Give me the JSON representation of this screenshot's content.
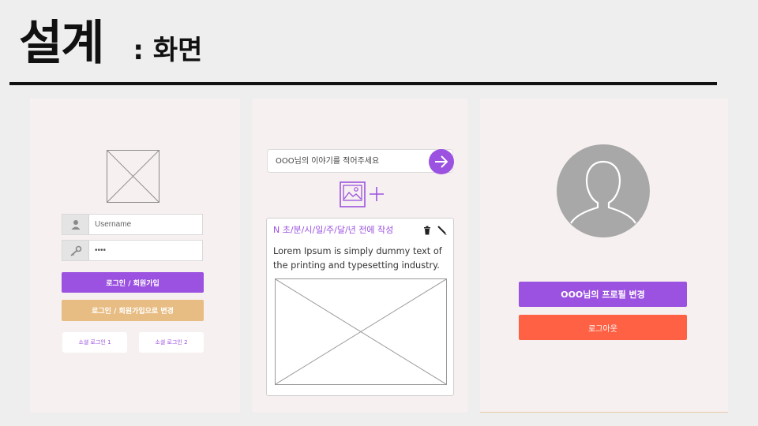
{
  "slide": {
    "title": "설계",
    "subtitle": ": 화면"
  },
  "login_screen": {
    "username_placeholder": "Username",
    "password_value": "••••",
    "login_button": "로그인 / 회원가입",
    "switch_button": "로그인 / 회원가입으로 변경",
    "social_login_1": "소셜 로그인 1",
    "social_login_2": "소셜 로그인 2",
    "icons": [
      "user-icon",
      "key-icon",
      "image-placeholder-icon"
    ]
  },
  "feed_screen": {
    "story_placeholder": "OOO님의 이야기를 적어주세요",
    "post": {
      "meta": "N 초/분/시/일/주/달/년 전에 작성",
      "body": "Lorem Ipsum is simply dummy text of the printing and typesetting industry."
    },
    "icons": [
      "arrow-right-icon",
      "add-image-icon",
      "trash-icon",
      "pencil-icon"
    ]
  },
  "profile_screen": {
    "edit_profile_button": "OOO님의 프로필 변경",
    "logout_button": "로그아웃",
    "icons": [
      "avatar-icon"
    ]
  },
  "colors": {
    "accent_purple": "#9b52e0",
    "accent_orange": "#e8bd84",
    "logout_red": "#ff6145",
    "panel_bg": "#f7f0f0"
  }
}
